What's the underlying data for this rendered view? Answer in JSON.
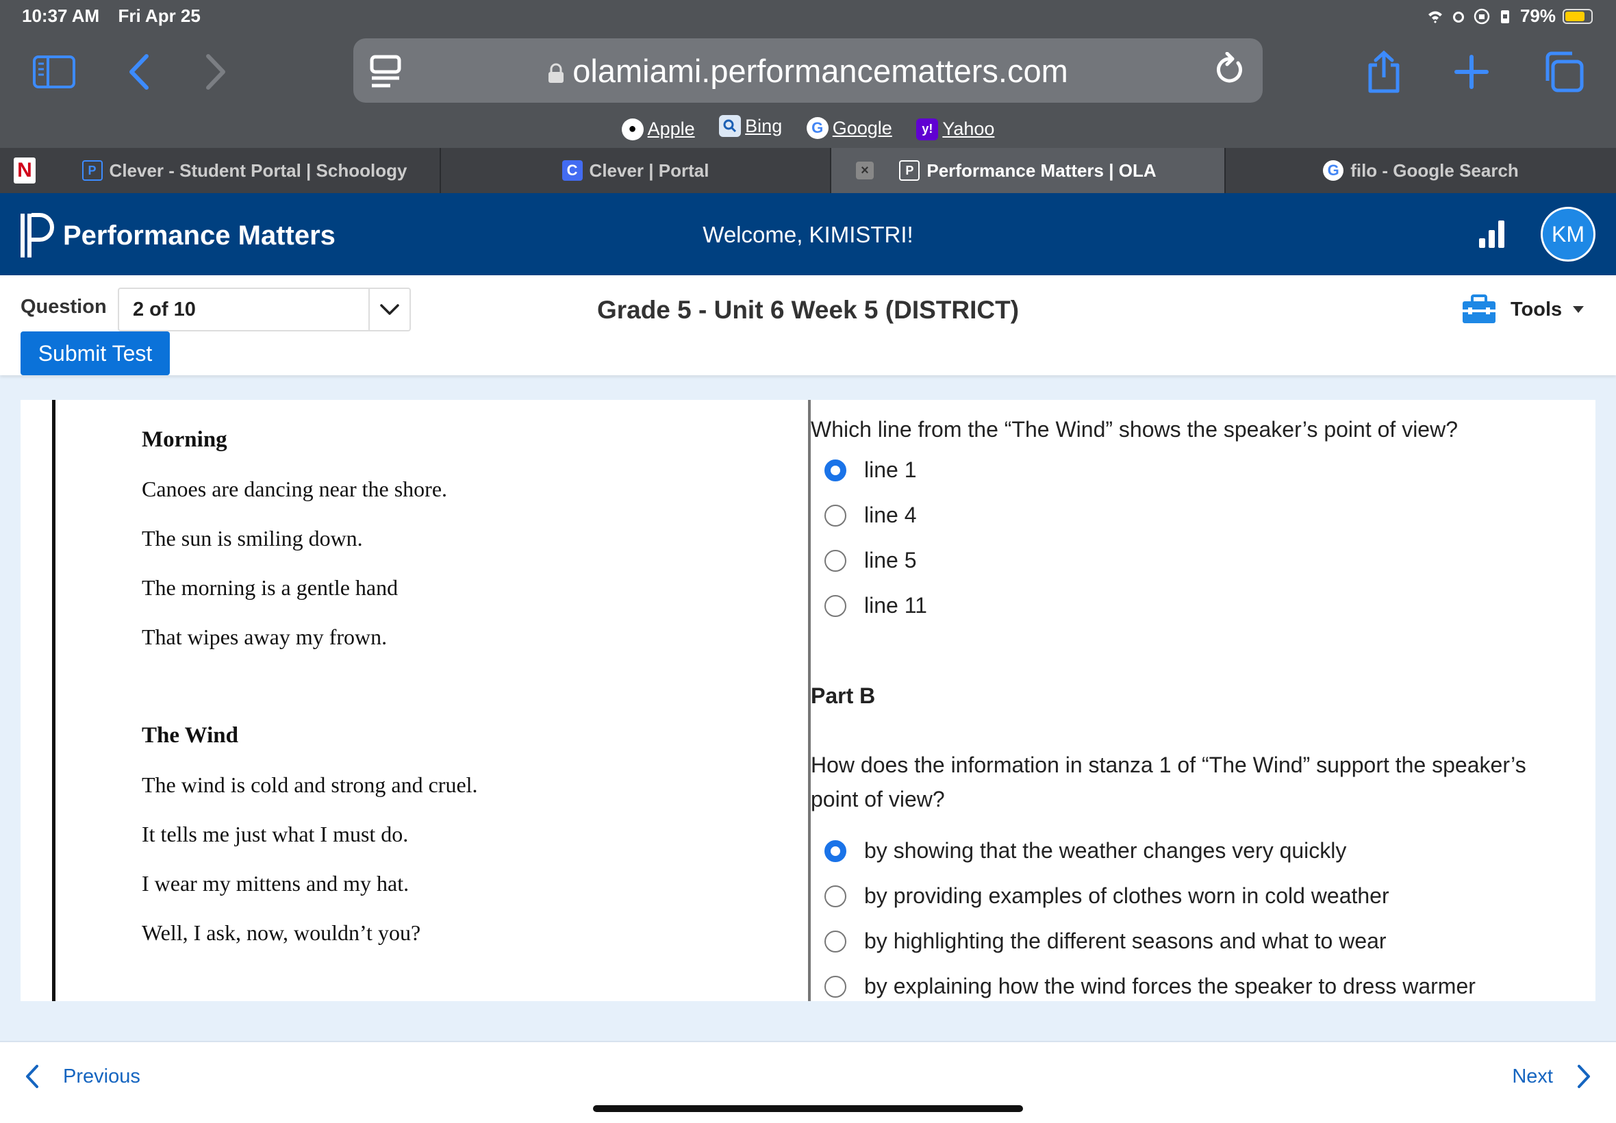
{
  "status_bar": {
    "time": "10:37 AM",
    "date": "Fri Apr 25",
    "battery": "79%",
    "battery_level": 0.79
  },
  "browser": {
    "url": "olamiami.performancematters.com",
    "favorites": [
      {
        "label": "Apple",
        "icon": "apple-icon"
      },
      {
        "label": "Bing",
        "icon": "bing-icon"
      },
      {
        "label": "Google",
        "icon": "google-icon"
      },
      {
        "label": "Yahoo",
        "icon": "yahoo-icon"
      }
    ],
    "tabs": [
      {
        "label": "Clever - Student Portal | Schoology",
        "icon": "schoology-icon",
        "active": false
      },
      {
        "label": "Clever | Portal",
        "icon": "clever-icon",
        "active": false
      },
      {
        "label": "Performance Matters | OLA",
        "icon": "performance-matters-icon",
        "active": true
      },
      {
        "label": "filo - Google Search",
        "icon": "google-icon",
        "active": false
      }
    ],
    "colors": {
      "chrome": "#505357",
      "accent": "#3d8bfd"
    }
  },
  "app": {
    "brand": "Performance Matters",
    "welcome": "Welcome, KIMISTRI!",
    "avatar_initials": "KM",
    "colors": {
      "header": "#004080",
      "submit": "#0b72d9",
      "radio_selected": "#1a73e8"
    }
  },
  "toolbar": {
    "question_label": "Question",
    "question_value": "2 of 10",
    "submit_label": "Submit Test",
    "test_title": "Grade 5 - Unit 6 Week 5 (DISTRICT)",
    "tools_label": "Tools"
  },
  "passage": {
    "poems": [
      {
        "title": "Morning",
        "lines": [
          "Canoes are dancing near the shore.",
          "The sun is smiling down.",
          "The morning is a gentle hand",
          "That wipes away my frown."
        ]
      },
      {
        "title": "The Wind",
        "lines": [
          "The wind is cold and strong and cruel.",
          "It tells me just what I must do.",
          "I wear my mittens and my hat.",
          "Well, I ask, now, wouldn’t you?"
        ]
      }
    ]
  },
  "questions": {
    "part_a": {
      "prompt": "Which line from the “The Wind” shows the speaker’s point of view?",
      "options": [
        "line 1",
        "line 4",
        "line 5",
        "line 11"
      ],
      "selected_index": 0
    },
    "part_b": {
      "heading": "Part B",
      "prompt": "How does the information in stanza 1 of “The Wind” support the speaker’s point of view?",
      "options": [
        "by showing that the weather changes very quickly",
        "by providing examples of clothes worn in cold weather",
        "by highlighting the different seasons and what to wear",
        "by explaining how the wind forces the speaker to dress warmer"
      ],
      "selected_index": 0
    }
  },
  "nav": {
    "previous_label": "Previous",
    "next_label": "Next"
  }
}
